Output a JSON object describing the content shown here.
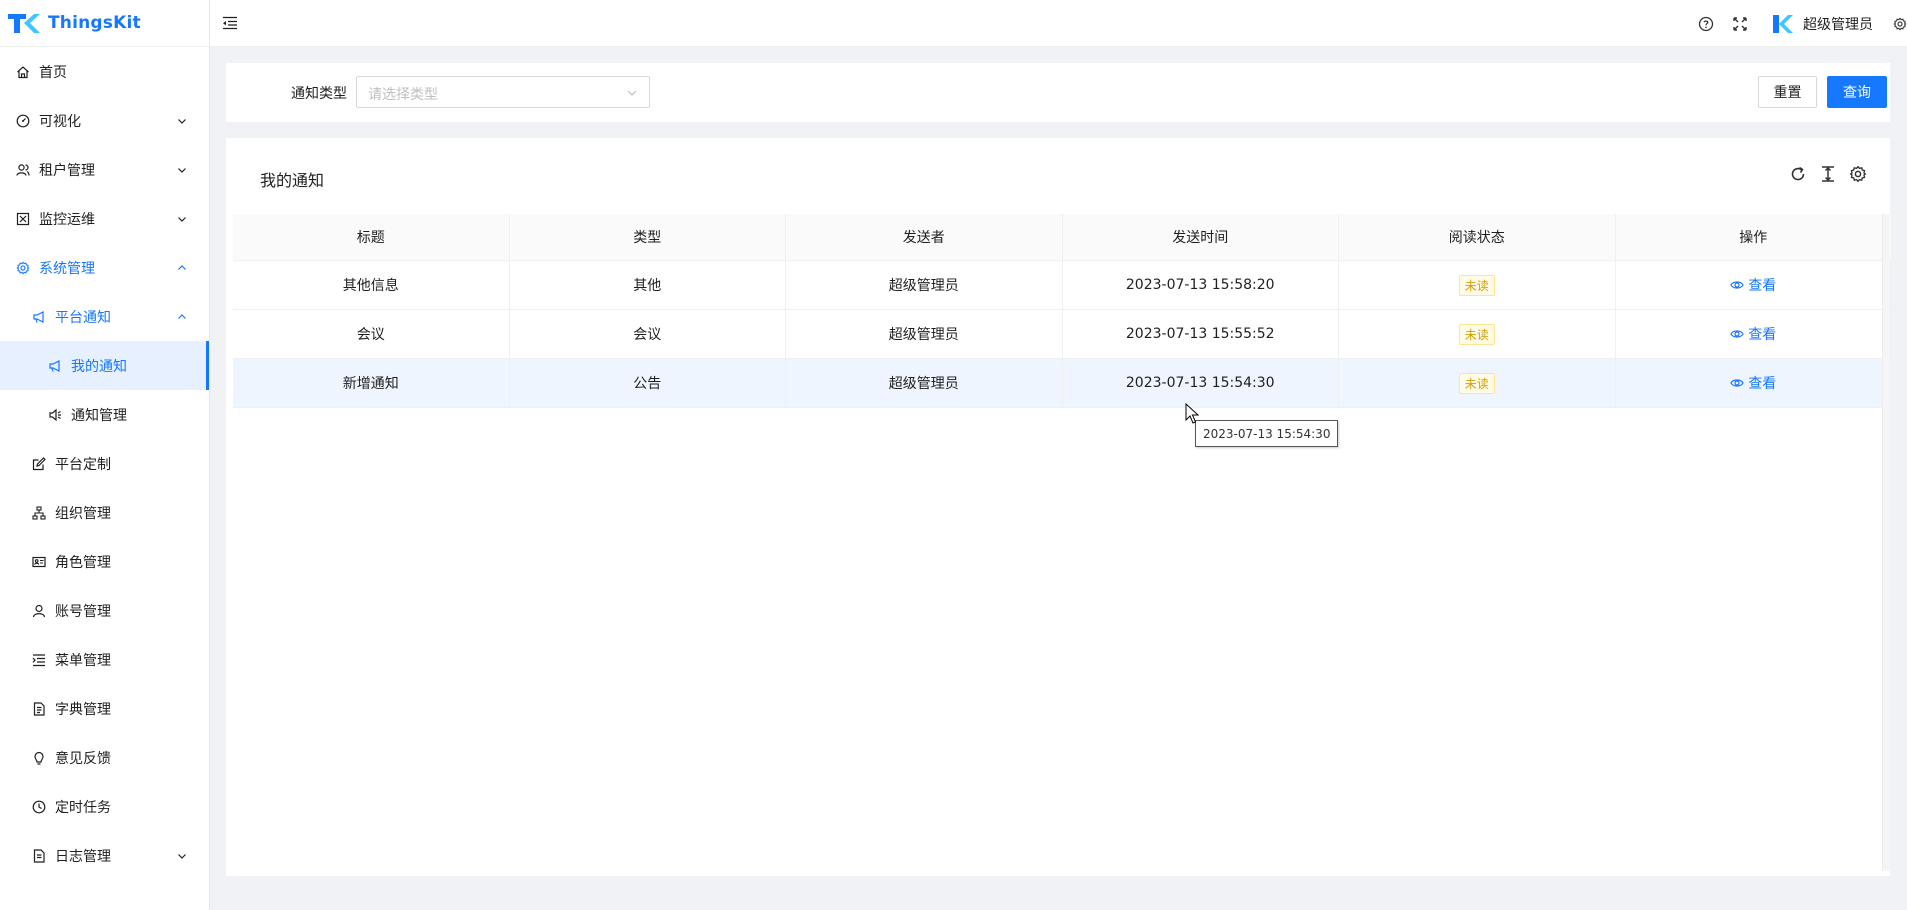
{
  "app": {
    "name": "ThingsKit",
    "brand_color": "#1677ff"
  },
  "sidebar": {
    "items": [
      {
        "label": "首页",
        "icon": "home-icon",
        "level": 1,
        "arrow": false
      },
      {
        "label": "可视化",
        "icon": "dashboard-icon",
        "level": 1,
        "arrow": "down"
      },
      {
        "label": "租户管理",
        "icon": "users-icon",
        "level": 1,
        "arrow": "down"
      },
      {
        "label": "监控运维",
        "icon": "monitor-icon",
        "level": 1,
        "arrow": "down"
      },
      {
        "label": "系统管理",
        "icon": "gear-icon",
        "level": 1,
        "arrow": "up",
        "active": true
      },
      {
        "label": "平台通知",
        "icon": "megaphone-icon",
        "level": 2,
        "arrow": "up",
        "active": true
      },
      {
        "label": "我的通知",
        "icon": "megaphone-icon",
        "level": 3,
        "arrow": false,
        "selected": true
      },
      {
        "label": "通知管理",
        "icon": "speaker-icon",
        "level": 3,
        "arrow": false
      },
      {
        "label": "平台定制",
        "icon": "edit-icon",
        "level": 2,
        "arrow": false
      },
      {
        "label": "组织管理",
        "icon": "org-icon",
        "level": 2,
        "arrow": false
      },
      {
        "label": "角色管理",
        "icon": "id-card-icon",
        "level": 2,
        "arrow": false
      },
      {
        "label": "账号管理",
        "icon": "user-icon",
        "level": 2,
        "arrow": false
      },
      {
        "label": "菜单管理",
        "icon": "menu-list-icon",
        "level": 2,
        "arrow": false
      },
      {
        "label": "字典管理",
        "icon": "file-icon",
        "level": 2,
        "arrow": false
      },
      {
        "label": "意见反馈",
        "icon": "bulb-icon",
        "level": 2,
        "arrow": false
      },
      {
        "label": "定时任务",
        "icon": "clock-icon",
        "level": 2,
        "arrow": false
      },
      {
        "label": "日志管理",
        "icon": "file-text-icon",
        "level": 2,
        "arrow": "down"
      }
    ]
  },
  "header": {
    "user_name": "超级管理员"
  },
  "filter": {
    "label": "通知类型",
    "placeholder": "请选择类型",
    "reset_label": "重置",
    "query_label": "查询"
  },
  "table": {
    "title": "我的通知",
    "columns": [
      "标题",
      "类型",
      "发送者",
      "发送时间",
      "阅读状态",
      "操作"
    ],
    "rows": [
      {
        "title": "其他信息",
        "type": "其他",
        "sender": "超级管理员",
        "time": "2023-07-13 15:58:20",
        "status": "未读",
        "action": "查看"
      },
      {
        "title": "会议",
        "type": "会议",
        "sender": "超级管理员",
        "time": "2023-07-13 15:55:52",
        "status": "未读",
        "action": "查看"
      },
      {
        "title": "新增通知",
        "type": "公告",
        "sender": "超级管理员",
        "time": "2023-07-13 15:54:30",
        "status": "未读",
        "action": "查看"
      }
    ]
  },
  "tooltip": {
    "text": "2023-07-13 15:54:30"
  }
}
